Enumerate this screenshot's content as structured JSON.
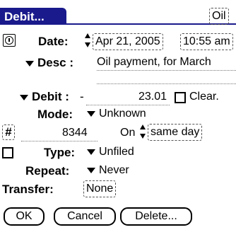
{
  "colors": {
    "title_bar": "#1a1a8c"
  },
  "title": "Debit...",
  "category_label": "Oil",
  "date_label": "Date:",
  "date_value": "Apr 21, 2005",
  "time_value": "10:55 am",
  "desc_label": "Desc :",
  "desc_value": "Oil payment, for March",
  "debit_label": "Debit :",
  "debit_sign": "-",
  "debit_amount": "23.01",
  "cleared_label": "Clear.",
  "mode_label": "Mode:",
  "mode_value": "Unknown",
  "number_button": "#",
  "check_number": "8344",
  "on_label": "On",
  "on_value": "same day",
  "type_label": "Type:",
  "type_value": "Unfiled",
  "repeat_label": "Repeat:",
  "repeat_value": "Never",
  "transfer_label": "Transfer:",
  "transfer_value": "None",
  "buttons": {
    "ok": "OK",
    "cancel": "Cancel",
    "delete": "Delete..."
  }
}
